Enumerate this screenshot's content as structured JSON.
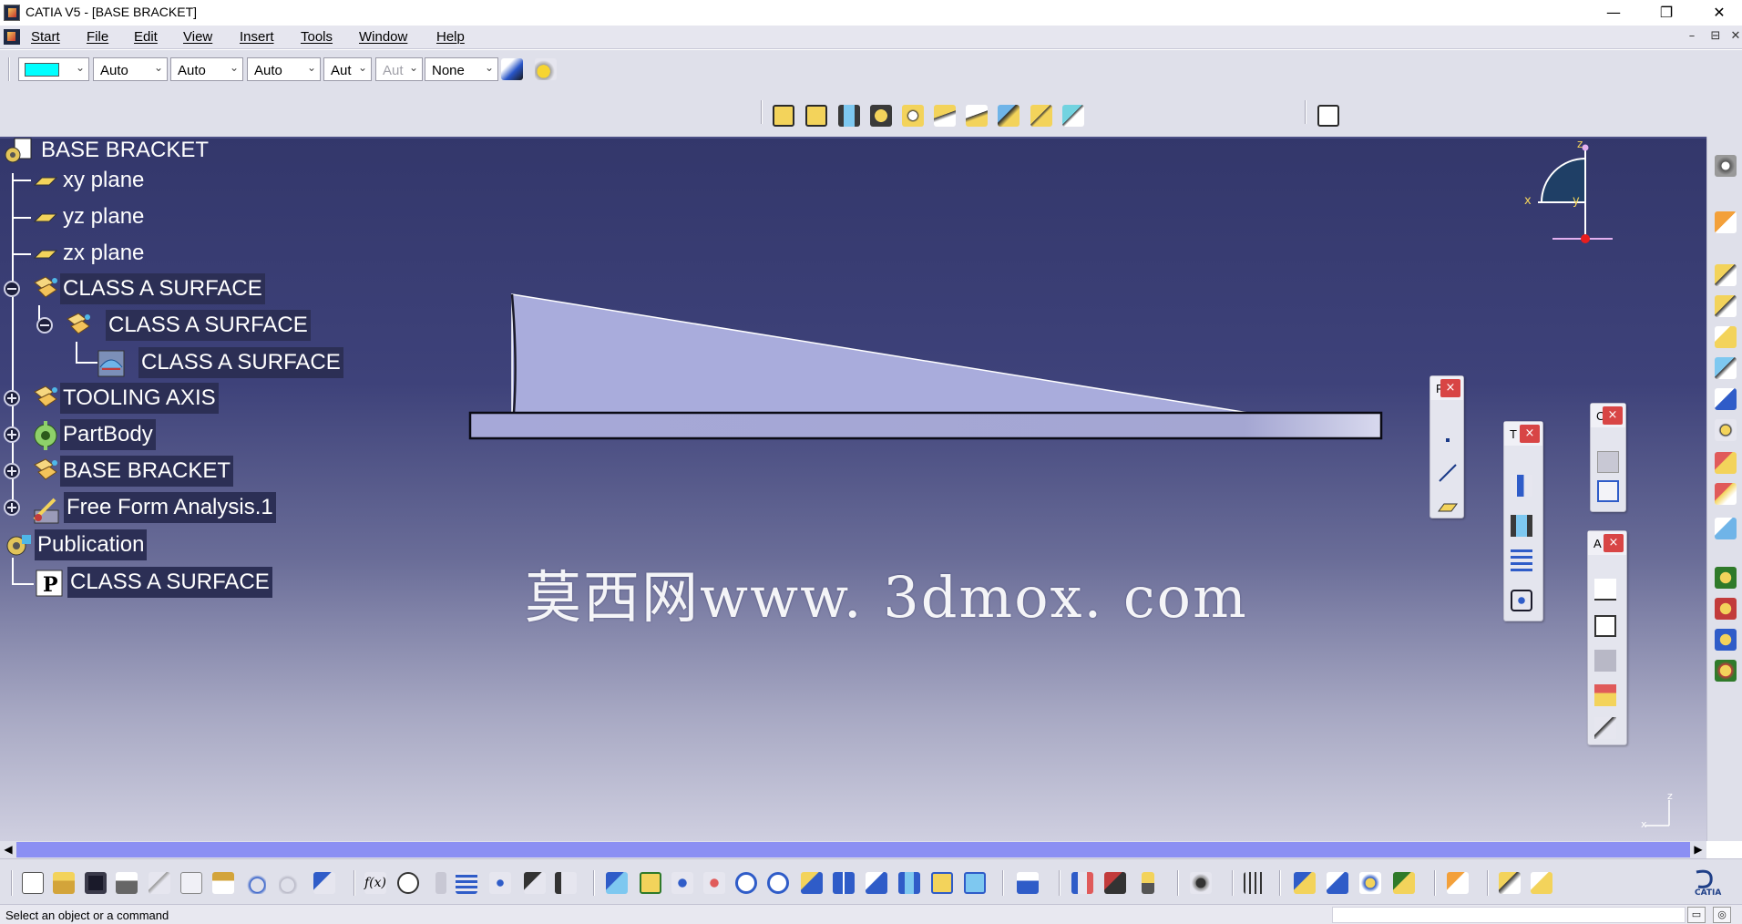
{
  "window": {
    "title": "CATIA V5 - [BASE BRACKET]",
    "controls": [
      "—",
      "❐",
      "✕"
    ],
    "mdi_controls": [
      "–",
      "⊟",
      "✕"
    ]
  },
  "menu": {
    "items": [
      "Start",
      "File",
      "Edit",
      "View",
      "Insert",
      "Tools",
      "Window",
      "Help"
    ]
  },
  "graphic_properties": {
    "color_value": "#00ffff",
    "transparency": "Auto",
    "line_thickness": "Auto",
    "line_type": "Auto",
    "point_type": "Aut",
    "layer_disabled": "Aut",
    "layer": "None"
  },
  "tree": {
    "root": "BASE BRACKET",
    "planes": [
      "xy plane",
      "yz plane",
      "zx plane"
    ],
    "class_a_1": "CLASS A SURFACE",
    "class_a_2": "CLASS A SURFACE",
    "class_a_3": "CLASS A SURFACE",
    "tooling_axis": "TOOLING AXIS",
    "partbody": "PartBody",
    "base_bracket": "BASE BRACKET",
    "free_form": "Free Form Analysis.1",
    "publication": "Publication",
    "publication_item": "CLASS A SURFACE"
  },
  "compass": {
    "z": "z",
    "x": "x",
    "y": "y"
  },
  "axis_triad": {
    "z": "z",
    "x": "x"
  },
  "panels": {
    "p1_title": "F",
    "p2_title": "T",
    "p3_title": "C",
    "p4_title": "A",
    "close": "×"
  },
  "watermark": "莫西网www. 3dmox. com",
  "scroll": {
    "left": "◀",
    "right": "▶"
  },
  "status": {
    "message": "Select an object or a command"
  },
  "colors": {
    "viewport_top": "#33376b",
    "viewport_bottom": "#cfcfe0",
    "part_fill": "#a8acdc",
    "scroll_track": "#8b8ff3",
    "close_red": "#d84545"
  }
}
